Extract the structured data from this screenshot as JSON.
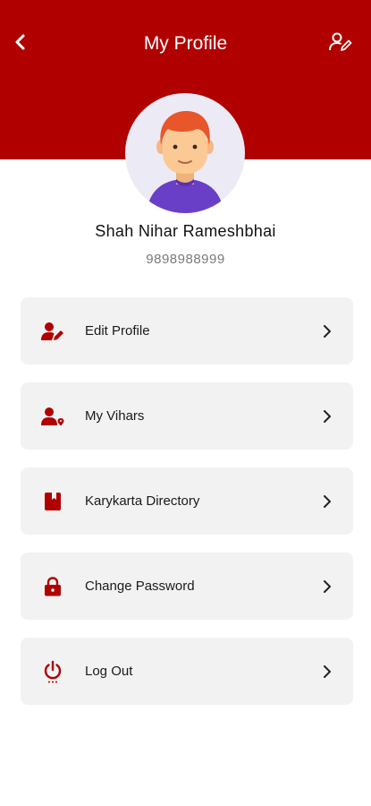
{
  "header": {
    "title": "My Profile",
    "background_color": "#b00000",
    "back_icon": "chevron-left-icon",
    "action_icon": "user-edit-icon"
  },
  "profile": {
    "name": "Shah Nihar Rameshbhai",
    "phone": "9898988999",
    "avatar_icon": "avatar-illustration"
  },
  "menu": {
    "items": [
      {
        "label": "Edit Profile",
        "icon": "user-edit-icon"
      },
      {
        "label": "My Vihars",
        "icon": "user-location-icon"
      },
      {
        "label": "Karykarta Directory",
        "icon": "directory-book-icon"
      },
      {
        "label": "Change Password",
        "icon": "lock-icon"
      },
      {
        "label": "Log Out",
        "icon": "power-icon"
      }
    ],
    "icon_color": "#b00000",
    "item_background": "#f2f2f2",
    "trailing_icon": "chevron-right-icon"
  }
}
